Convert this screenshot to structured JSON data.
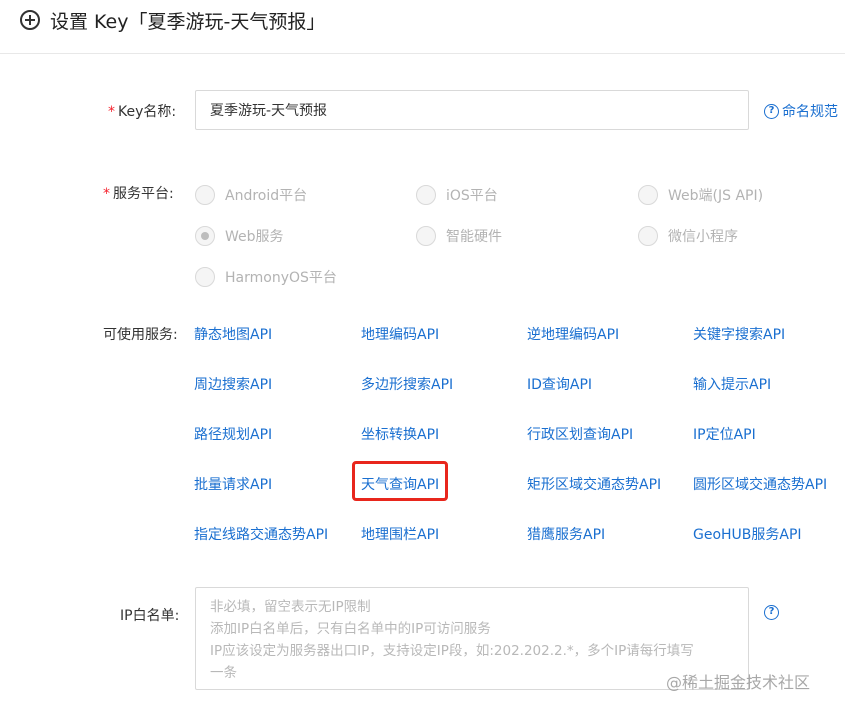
{
  "header": {
    "title": "设置 Key「夏季游玩-天气预报」"
  },
  "form": {
    "key_name": {
      "required_mark": "*",
      "label": "Key名称:",
      "value": "夏季游玩-天气预报",
      "help_text": "命名规范"
    },
    "platform": {
      "required_mark": "*",
      "label": "服务平台:",
      "options": [
        {
          "label": "Android平台",
          "checked": false
        },
        {
          "label": "iOS平台",
          "checked": false
        },
        {
          "label": "Web端(JS API)",
          "checked": false
        },
        {
          "label": "Web服务",
          "checked": true
        },
        {
          "label": "智能硬件",
          "checked": false
        },
        {
          "label": "微信小程序",
          "checked": false
        },
        {
          "label": "HarmonyOS平台",
          "checked": false
        }
      ]
    },
    "services": {
      "label": "可使用服务:",
      "items": [
        "静态地图API",
        "地理编码API",
        "逆地理编码API",
        "关键字搜索API",
        "周边搜索API",
        "多边形搜索API",
        "ID查询API",
        "输入提示API",
        "路径规划API",
        "坐标转换API",
        "行政区划查询API",
        "IP定位API",
        "批量请求API",
        "天气查询API",
        "矩形区域交通态势API",
        "圆形区域交通态势API",
        "指定线路交通态势API",
        "地理围栏API",
        "猎鹰服务API",
        "GeoHUB服务API"
      ],
      "highlighted": "天气查询API"
    },
    "ip_whitelist": {
      "label": "IP白名单:",
      "placeholder_lines": [
        "非必填，留空表示无IP限制",
        "添加IP白名单后，只有白名单中的IP可访问服务",
        "IP应该设定为服务器出口IP，支持设定IP段，如:202.202.2.*，多个IP请每行填写",
        "一条"
      ]
    }
  },
  "watermark": "@稀土掘金技术社区",
  "colors": {
    "link": "#1a6fd0",
    "required": "#f5222d",
    "highlight": "#e8261c"
  }
}
